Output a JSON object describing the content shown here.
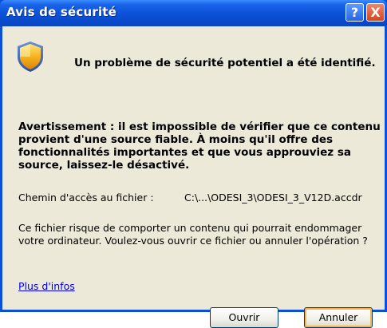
{
  "window": {
    "title": "Avis de sécurité",
    "help_label": "?",
    "close_label": "X"
  },
  "dialog": {
    "headline": "Un problème de sécurité potentiel a été identifié.",
    "warning": "Avertissement : il est impossible de vérifier que ce contenu provient d'une source fiable. À moins qu'il offre des fonctionnalités importantes et que vous approuviez sa source, laissez-le désactivé.",
    "path_label": "Chemin d'accès au fichier :",
    "path_value": "C:\\...\\ODESI_3\\ODESI_3_V12D.accdr",
    "info": "Ce fichier risque de comporter un contenu qui pourrait endommager votre ordinateur. Voulez-vous ouvrir ce fichier ou annuler l'opération ?",
    "more_link": "Plus d'infos"
  },
  "buttons": {
    "open": "Ouvrir",
    "cancel": "Annuler"
  },
  "icons": {
    "shield": "shield-warning-icon"
  },
  "colors": {
    "titlebar": "#0b50d6",
    "client": "#ece9d8",
    "close": "#d6451e",
    "link": "#0000ee"
  }
}
